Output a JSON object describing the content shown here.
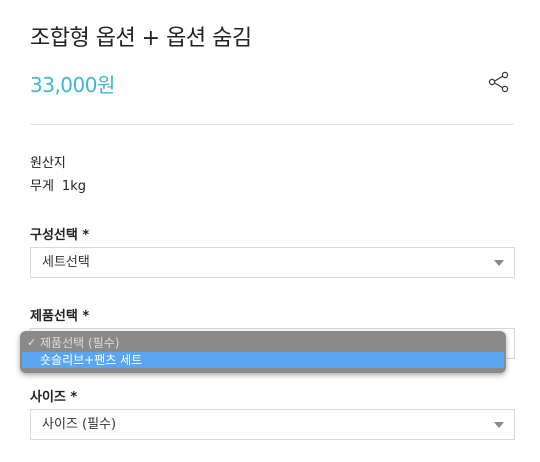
{
  "product": {
    "title": "조합형 옵션 + 옵션 숨김",
    "price": "33,000원"
  },
  "info": {
    "origin_label": "원산지",
    "weight_label": "무게",
    "weight_value": "1kg"
  },
  "options": {
    "composition": {
      "label": "구성선택 *",
      "selected": "세트선택"
    },
    "product": {
      "label": "제품선택 *",
      "dropdown": [
        {
          "text": "제품선택 (필수)",
          "checked": true
        },
        {
          "text": "숏슬리브+팬츠 세트",
          "highlighted": true
        }
      ]
    },
    "size": {
      "label": "사이즈 *",
      "selected": "사이즈 (필수)"
    }
  },
  "colors": {
    "price": "#3fb7cf",
    "highlight": "#5aa6f2"
  },
  "icons": {
    "share": "share-icon",
    "dropdown_arrow": "chevron-down-icon",
    "check": "checkmark-icon"
  }
}
